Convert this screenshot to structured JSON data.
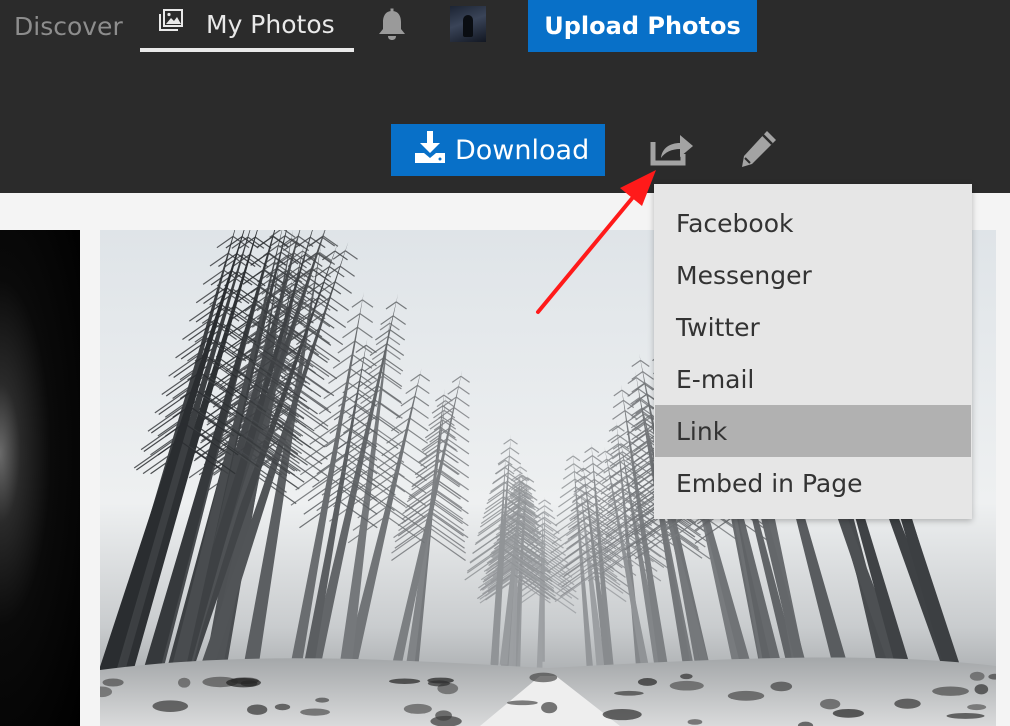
{
  "nav": {
    "discover": "Discover",
    "my_photos": "My Photos"
  },
  "header": {
    "upload_label": "Upload Photos"
  },
  "toolbar": {
    "download_label": "Download"
  },
  "share_menu": {
    "items": [
      "Facebook",
      "Messenger",
      "Twitter",
      "E-mail",
      "Link",
      "Embed in Page"
    ],
    "highlighted": "Link"
  },
  "icons": {
    "nav_photos": "photos-icon",
    "bell": "bell-icon",
    "download": "download-icon",
    "share": "share-icon",
    "edit": "pencil-icon"
  },
  "colors": {
    "topbar": "#2b2b2b",
    "primary_button": "#0870c8",
    "menu_background": "#e6e6e6",
    "menu_highlight": "#b1b1b1",
    "annotation_arrow": "#ff1a1a"
  }
}
